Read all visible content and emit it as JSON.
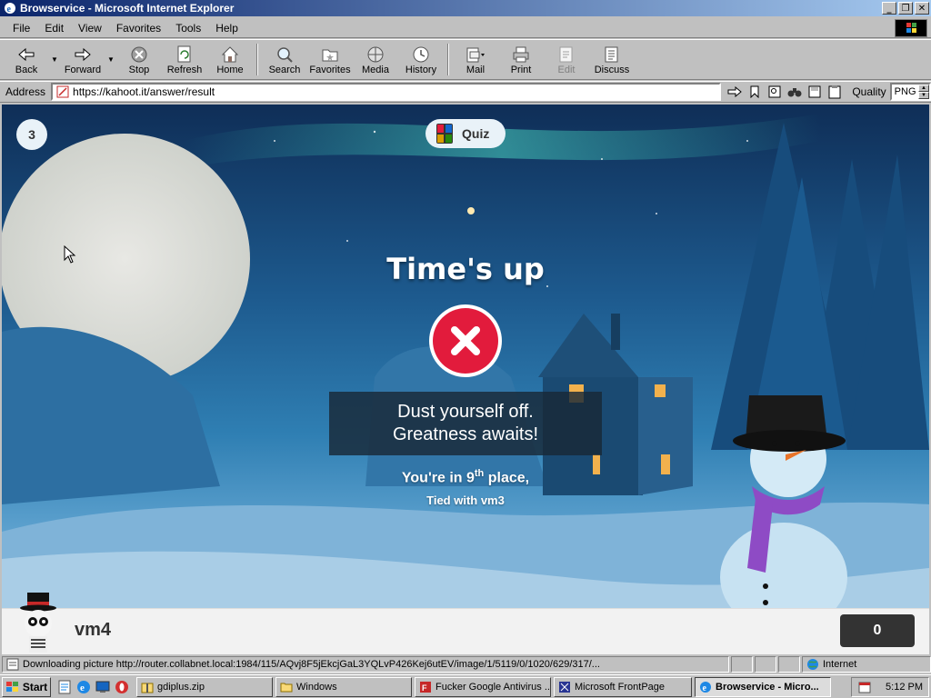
{
  "window": {
    "title": "Browservice - Microsoft Internet Explorer",
    "controls": {
      "minimize": "_",
      "restore": "❐",
      "close": "✕"
    }
  },
  "menu": [
    "File",
    "Edit",
    "View",
    "Favorites",
    "Tools",
    "Help"
  ],
  "toolbar": {
    "back": "Back",
    "forward": "Forward",
    "stop": "Stop",
    "refresh": "Refresh",
    "home": "Home",
    "search": "Search",
    "favorites": "Favorites",
    "media": "Media",
    "history": "History",
    "mail": "Mail",
    "print": "Print",
    "edit": "Edit",
    "discuss": "Discuss"
  },
  "address": {
    "label": "Address",
    "url": "https://kahoot.it/answer/result",
    "quality_label": "Quality",
    "quality_value": "PNG"
  },
  "kahoot": {
    "question_number": "3",
    "quiz_label": "Quiz",
    "headline": "Time's up",
    "message_line1": "Dust yourself off.",
    "message_line2": "Greatness awaits!",
    "place_prefix": "You're in ",
    "place_number": "9",
    "place_suffix": "th",
    "place_end": " place,",
    "tied_text": "Tied with vm3",
    "player_name": "vm4",
    "score": "0",
    "colors": {
      "incorrect": "#e21b3c",
      "score_bg": "#333333"
    }
  },
  "status": {
    "text": "Downloading picture http://router.collabnet.local:1984/115/AQvj8F5jEkcjGaL3YQLvP426Kej6utEV/image/1/5119/0/1020/629/317/...",
    "zone": "Internet"
  },
  "taskbar": {
    "start": "Start",
    "tasks": [
      {
        "label": "gdiplus.zip",
        "active": false
      },
      {
        "label": "Windows",
        "active": false
      },
      {
        "label": "Fucker Google Antivirus ...",
        "active": false
      },
      {
        "label": "Microsoft FrontPage",
        "active": false
      },
      {
        "label": "Browservice - Micro...",
        "active": true
      }
    ],
    "clock": "5:12 PM"
  }
}
